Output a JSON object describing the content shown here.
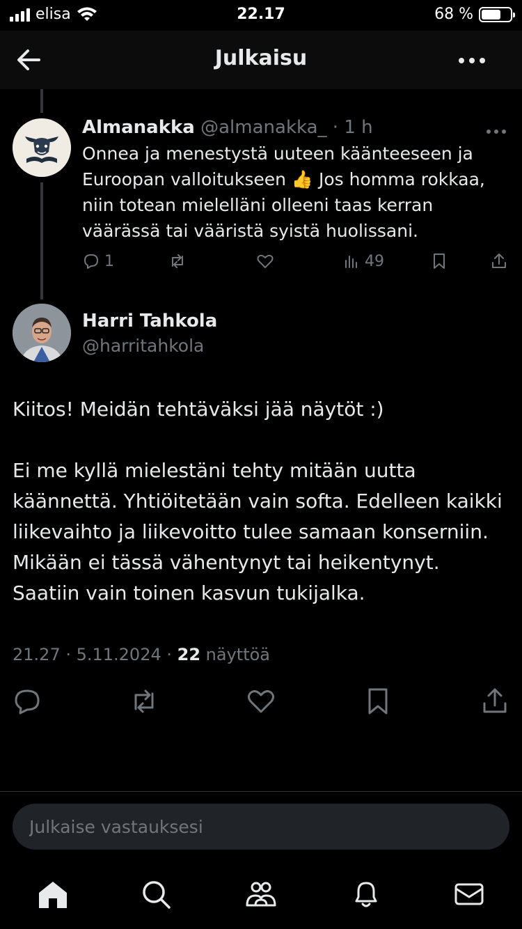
{
  "status_bar": {
    "carrier": "elisa",
    "time": "22.17",
    "battery_percent": "68 %",
    "battery_level": 0.68
  },
  "header": {
    "title": "Julkaisu"
  },
  "reply": {
    "name": "Almanakka",
    "handle": "@almanakka_",
    "separator": " · ",
    "age": "1 h",
    "text": "Onnea ja menestystä uuteen käänteeseen ja Euroopan valloitukseen 👍 Jos homma rokkaa, niin totean mielelläni olleeni taas kerran väärässä tai vääristä syistä huolissani.",
    "reply_count": "1",
    "view_count": "49"
  },
  "post": {
    "name": "Harri Tahkola",
    "handle": "@harritahkola",
    "paragraph_1": "Kiitos! Meidän tehtäväksi jää näytöt :)",
    "paragraph_2": "Ei me kyllä mielestäni tehty mitään uutta käännettä. Yhtiöitetään vain softa. Edelleen kaikki liikevaihto ja liikevoitto tulee samaan konserniin. Mikään ei tässä vähentynyt tai heikentynyt. Saatiin vain toinen kasvun tukijalka.",
    "timestamp": "21.27 · 5.11.2024 · ",
    "views_count": "22",
    "views_label": " näyttöä"
  },
  "composer": {
    "placeholder": "Julkaise vastauksesi"
  },
  "tabbar": {
    "items": [
      "home-icon",
      "search-icon",
      "communities-icon",
      "notifications-icon",
      "messages-icon"
    ]
  },
  "colors": {
    "background": "#000000",
    "text": "#e7e9ea",
    "muted": "#71767b",
    "divider": "#2f3336"
  }
}
